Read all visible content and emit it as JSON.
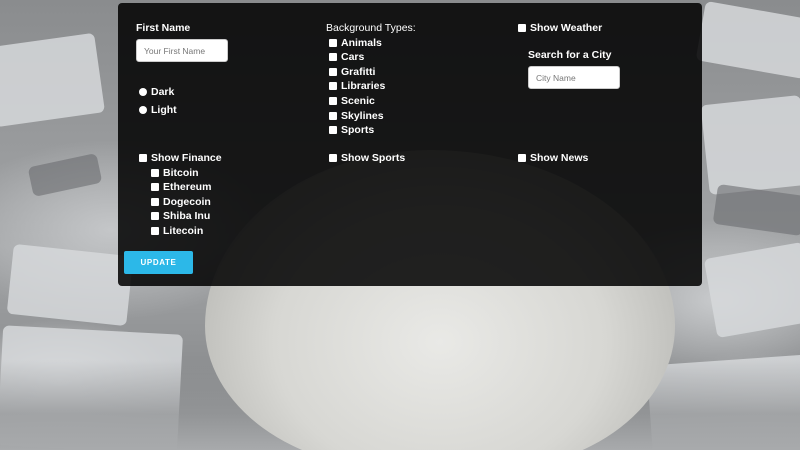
{
  "form": {
    "first_name_label": "First Name",
    "first_name_placeholder": "Your First Name",
    "first_name_value": "",
    "theme": {
      "options": [
        {
          "label": "Dark",
          "checked": false
        },
        {
          "label": "Light",
          "checked": false
        }
      ]
    },
    "background_types": {
      "label": "Background Types:",
      "options": [
        {
          "label": "Animals",
          "checked": false
        },
        {
          "label": "Cars",
          "checked": false
        },
        {
          "label": "Grafitti",
          "checked": false
        },
        {
          "label": "Libraries",
          "checked": false
        },
        {
          "label": "Scenic",
          "checked": false
        },
        {
          "label": "Skylines",
          "checked": false
        },
        {
          "label": "Sports",
          "checked": false
        }
      ]
    },
    "weather": {
      "show_label": "Show Weather",
      "checked": false,
      "city_label": "Search for a City",
      "city_placeholder": "City Name",
      "city_value": ""
    },
    "finance": {
      "show_label": "Show Finance",
      "checked": false,
      "options": [
        {
          "label": "Bitcoin",
          "checked": false
        },
        {
          "label": "Ethereum",
          "checked": false
        },
        {
          "label": "Dogecoin",
          "checked": false
        },
        {
          "label": "Shiba Inu",
          "checked": false
        },
        {
          "label": "Litecoin",
          "checked": false
        }
      ]
    },
    "sports": {
      "show_label": "Show Sports",
      "checked": false
    },
    "news": {
      "show_label": "Show News",
      "checked": false
    },
    "update_label": "UPDATE"
  },
  "colors": {
    "panel_bg": "#000000",
    "accent": "#2cb8e8",
    "text": "#ffffff"
  },
  "icons": {
    "checkbox": "checkbox-unchecked",
    "radio": "radio-unselected"
  }
}
